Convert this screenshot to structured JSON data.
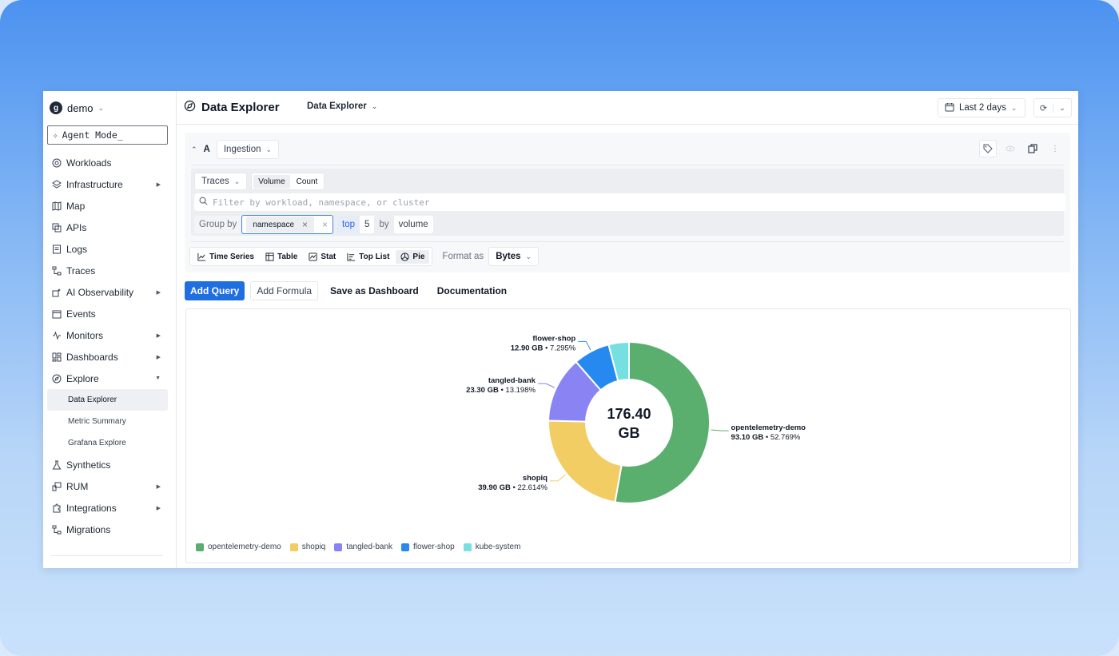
{
  "sidebar": {
    "org": {
      "logo": "g",
      "name": "demo"
    },
    "agent_mode": "Agent Mode_",
    "items": [
      {
        "label": "Workloads",
        "icon": "workloads-icon",
        "arrow": false
      },
      {
        "label": "Infrastructure",
        "icon": "layers-icon",
        "arrow": true
      },
      {
        "label": "Map",
        "icon": "map-icon",
        "arrow": false
      },
      {
        "label": "APIs",
        "icon": "api-icon",
        "arrow": false
      },
      {
        "label": "Logs",
        "icon": "logs-icon",
        "arrow": false
      },
      {
        "label": "Traces",
        "icon": "traces-icon",
        "arrow": false
      },
      {
        "label": "AI Observability",
        "icon": "ai-icon",
        "arrow": true
      },
      {
        "label": "Events",
        "icon": "calendar-icon",
        "arrow": false
      },
      {
        "label": "Monitors",
        "icon": "pulse-icon",
        "arrow": true
      },
      {
        "label": "Dashboards",
        "icon": "dashboard-icon",
        "arrow": true
      },
      {
        "label": "Explore",
        "icon": "explore-icon",
        "arrow": true,
        "expanded": true
      }
    ],
    "explore_sub": [
      "Data Explorer",
      "Metric Summary",
      "Grafana Explore"
    ],
    "items_after": [
      {
        "label": "Synthetics",
        "icon": "flask-icon",
        "arrow": false
      },
      {
        "label": "RUM",
        "icon": "rum-icon",
        "arrow": true
      },
      {
        "label": "Integrations",
        "icon": "puzzle-icon",
        "arrow": true
      },
      {
        "label": "Migrations",
        "icon": "migrate-icon",
        "arrow": false
      }
    ]
  },
  "header": {
    "title": "Data Explorer",
    "breadcrumb": "Data Explorer",
    "time_range": "Last 2 days"
  },
  "query": {
    "letter": "A",
    "source": "Ingestion",
    "signal": "Traces",
    "modes": [
      "Volume",
      "Count"
    ],
    "filter_placeholder": "Filter by workload, namespace, or cluster",
    "group_by_label": "Group by",
    "group_by_value": "namespace",
    "top_label": "top",
    "top_n": "5",
    "by_label": "by",
    "by_value": "volume",
    "viz_types": [
      "Time Series",
      "Table",
      "Stat",
      "Top List",
      "Pie"
    ],
    "selected_viz": "Pie",
    "format_label": "Format as",
    "format_value": "Bytes"
  },
  "actions": {
    "add_query": "Add Query",
    "add_formula": "Add Formula",
    "save_dashboard": "Save as Dashboard",
    "documentation": "Documentation"
  },
  "chart_data": {
    "type": "pie",
    "center_label": [
      "176.40",
      "GB"
    ],
    "unit": "GB",
    "slices": [
      {
        "name": "opentelemetry-demo",
        "value": 93.1,
        "percent": 52.769,
        "label_value": "93.10 GB • 52.769%",
        "color": "#5aae6e"
      },
      {
        "name": "shopiq",
        "value": 39.9,
        "percent": 22.614,
        "label_value": "39.90 GB • 22.614%",
        "color": "#f2cd64"
      },
      {
        "name": "tangled-bank",
        "value": 23.3,
        "percent": 13.198,
        "label_value": "23.30 GB • 13.198%",
        "color": "#8a83f4"
      },
      {
        "name": "flower-shop",
        "value": 12.9,
        "percent": 7.295,
        "label_value": "12.90 GB • 7.295%",
        "color": "#2689f0"
      },
      {
        "name": "kube-system",
        "value": 7.2,
        "percent": 4.124,
        "label_value": "",
        "color": "#76dfe0"
      }
    ],
    "legend": [
      "opentelemetry-demo",
      "shopiq",
      "tangled-bank",
      "flower-shop",
      "kube-system"
    ]
  }
}
